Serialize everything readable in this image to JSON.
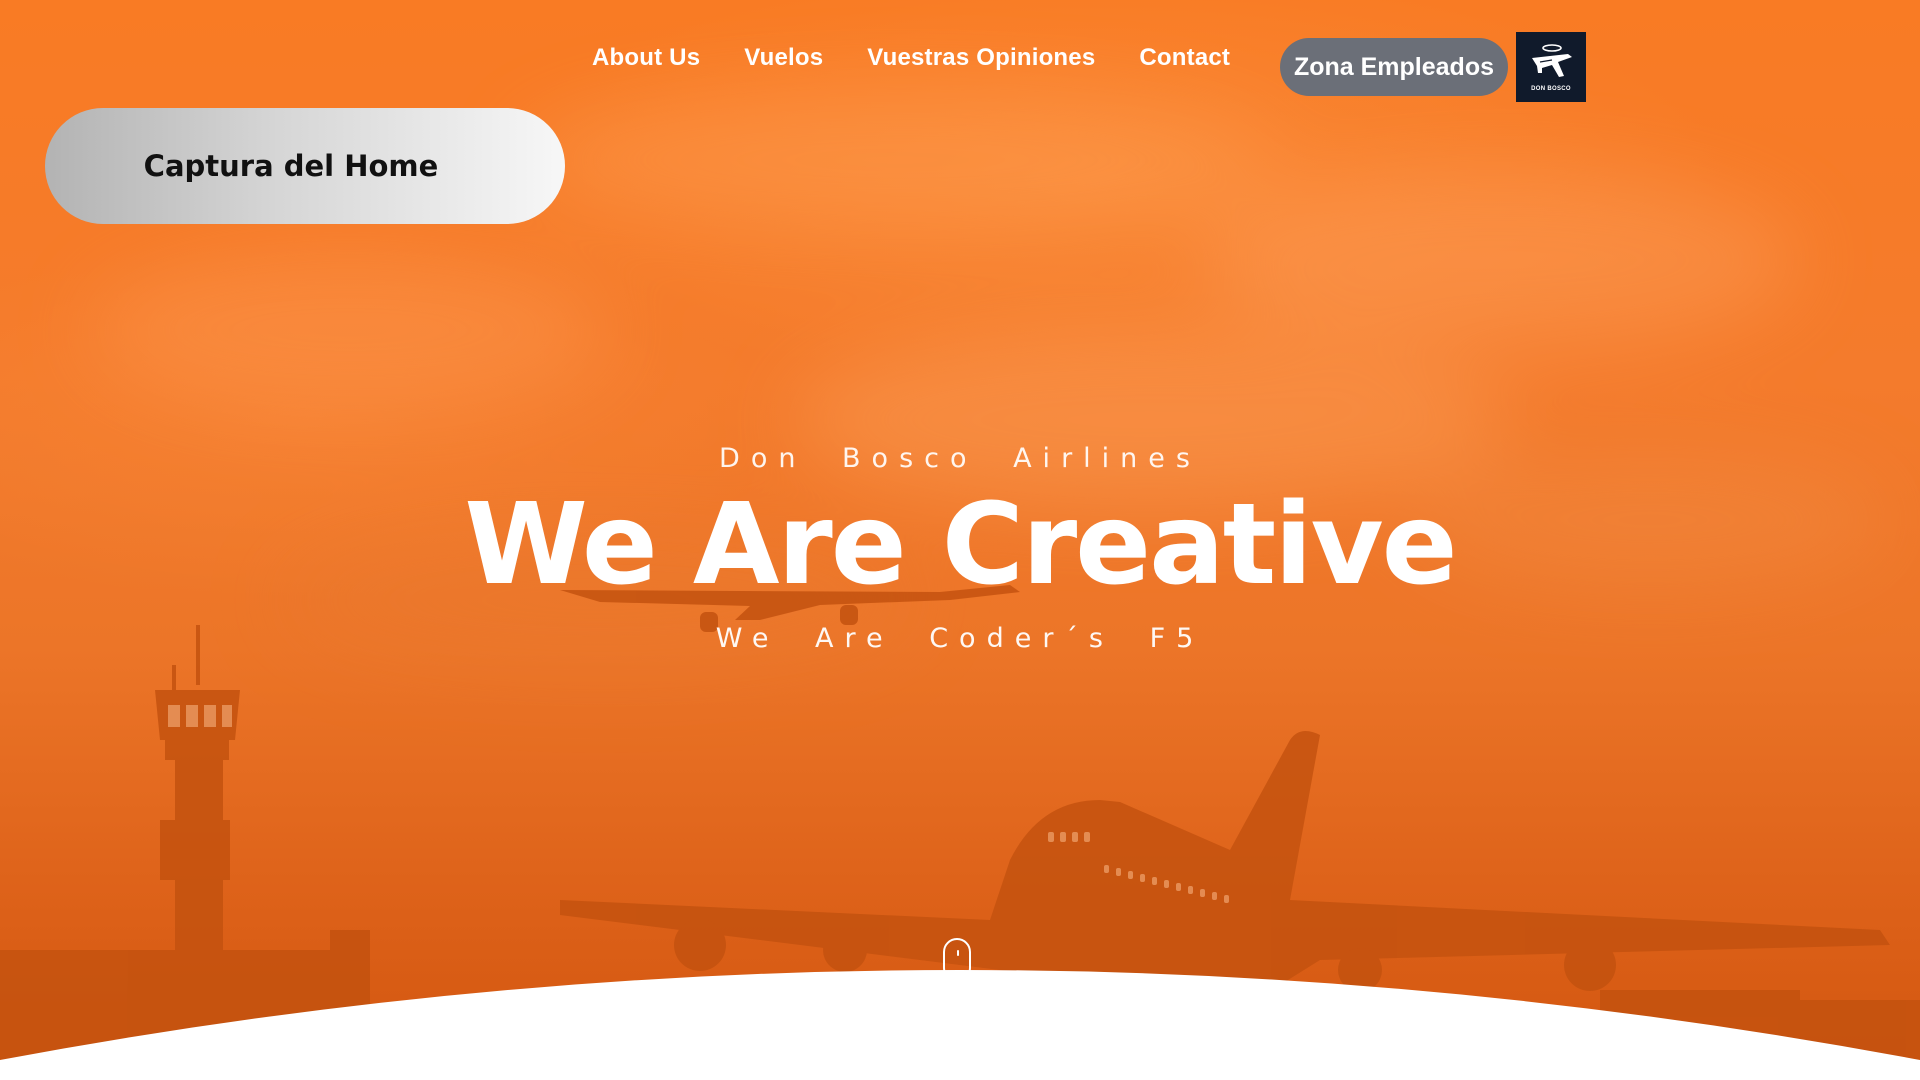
{
  "nav": {
    "items": [
      {
        "label": "About Us"
      },
      {
        "label": "Vuelos"
      },
      {
        "label": "Vuestras Opiniones"
      },
      {
        "label": "Contact"
      }
    ],
    "employee_button": "Zona Empleados",
    "logo_text": "DON BOSCO"
  },
  "caption": "Captura del Home",
  "hero": {
    "subtitle": "Don Bosco Airlines",
    "headline": "We Are Creative",
    "tagline": "We Are Coder´s F5"
  },
  "colors": {
    "accent": "#f47b2c",
    "button": "#6b6f78",
    "logo_bg": "#101a2b"
  },
  "icons": {
    "logo": "airplane-logo-icon",
    "scroll": "mouse-scroll-icon"
  }
}
